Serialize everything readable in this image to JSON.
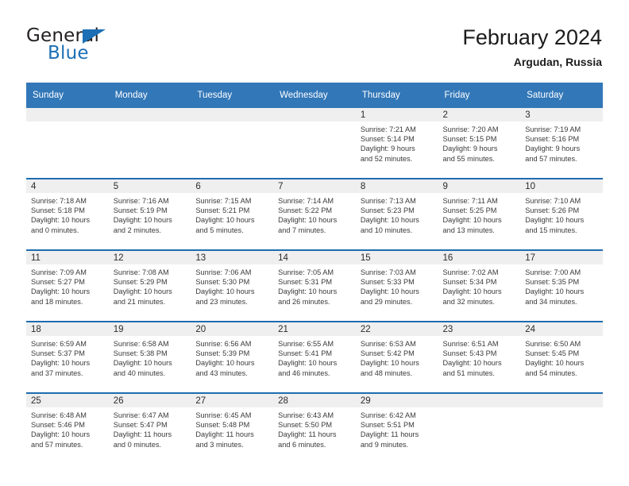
{
  "brand": {
    "name_part1": "General",
    "name_part2": "Blue",
    "logo_icon": "triangle-logo-icon"
  },
  "header": {
    "title": "February 2024",
    "location": "Argudan, Russia"
  },
  "colors": {
    "header_blue": "#3277b8",
    "row_divider_blue": "#1f6cb0",
    "daynum_band": "#efefef",
    "brand_blue": "#1c6fb5",
    "text": "#3a3a3a"
  },
  "calendar": {
    "weekday_headers": [
      "Sunday",
      "Monday",
      "Tuesday",
      "Wednesday",
      "Thursday",
      "Friday",
      "Saturday"
    ],
    "weeks": [
      [
        {
          "day": ""
        },
        {
          "day": ""
        },
        {
          "day": ""
        },
        {
          "day": ""
        },
        {
          "day": "1",
          "sunrise": "Sunrise: 7:21 AM",
          "sunset": "Sunset: 5:14 PM",
          "daylight_line1": "Daylight: 9 hours",
          "daylight_line2": "and 52 minutes."
        },
        {
          "day": "2",
          "sunrise": "Sunrise: 7:20 AM",
          "sunset": "Sunset: 5:15 PM",
          "daylight_line1": "Daylight: 9 hours",
          "daylight_line2": "and 55 minutes."
        },
        {
          "day": "3",
          "sunrise": "Sunrise: 7:19 AM",
          "sunset": "Sunset: 5:16 PM",
          "daylight_line1": "Daylight: 9 hours",
          "daylight_line2": "and 57 minutes."
        }
      ],
      [
        {
          "day": "4",
          "sunrise": "Sunrise: 7:18 AM",
          "sunset": "Sunset: 5:18 PM",
          "daylight_line1": "Daylight: 10 hours",
          "daylight_line2": "and 0 minutes."
        },
        {
          "day": "5",
          "sunrise": "Sunrise: 7:16 AM",
          "sunset": "Sunset: 5:19 PM",
          "daylight_line1": "Daylight: 10 hours",
          "daylight_line2": "and 2 minutes."
        },
        {
          "day": "6",
          "sunrise": "Sunrise: 7:15 AM",
          "sunset": "Sunset: 5:21 PM",
          "daylight_line1": "Daylight: 10 hours",
          "daylight_line2": "and 5 minutes."
        },
        {
          "day": "7",
          "sunrise": "Sunrise: 7:14 AM",
          "sunset": "Sunset: 5:22 PM",
          "daylight_line1": "Daylight: 10 hours",
          "daylight_line2": "and 7 minutes."
        },
        {
          "day": "8",
          "sunrise": "Sunrise: 7:13 AM",
          "sunset": "Sunset: 5:23 PM",
          "daylight_line1": "Daylight: 10 hours",
          "daylight_line2": "and 10 minutes."
        },
        {
          "day": "9",
          "sunrise": "Sunrise: 7:11 AM",
          "sunset": "Sunset: 5:25 PM",
          "daylight_line1": "Daylight: 10 hours",
          "daylight_line2": "and 13 minutes."
        },
        {
          "day": "10",
          "sunrise": "Sunrise: 7:10 AM",
          "sunset": "Sunset: 5:26 PM",
          "daylight_line1": "Daylight: 10 hours",
          "daylight_line2": "and 15 minutes."
        }
      ],
      [
        {
          "day": "11",
          "sunrise": "Sunrise: 7:09 AM",
          "sunset": "Sunset: 5:27 PM",
          "daylight_line1": "Daylight: 10 hours",
          "daylight_line2": "and 18 minutes."
        },
        {
          "day": "12",
          "sunrise": "Sunrise: 7:08 AM",
          "sunset": "Sunset: 5:29 PM",
          "daylight_line1": "Daylight: 10 hours",
          "daylight_line2": "and 21 minutes."
        },
        {
          "day": "13",
          "sunrise": "Sunrise: 7:06 AM",
          "sunset": "Sunset: 5:30 PM",
          "daylight_line1": "Daylight: 10 hours",
          "daylight_line2": "and 23 minutes."
        },
        {
          "day": "14",
          "sunrise": "Sunrise: 7:05 AM",
          "sunset": "Sunset: 5:31 PM",
          "daylight_line1": "Daylight: 10 hours",
          "daylight_line2": "and 26 minutes."
        },
        {
          "day": "15",
          "sunrise": "Sunrise: 7:03 AM",
          "sunset": "Sunset: 5:33 PM",
          "daylight_line1": "Daylight: 10 hours",
          "daylight_line2": "and 29 minutes."
        },
        {
          "day": "16",
          "sunrise": "Sunrise: 7:02 AM",
          "sunset": "Sunset: 5:34 PM",
          "daylight_line1": "Daylight: 10 hours",
          "daylight_line2": "and 32 minutes."
        },
        {
          "day": "17",
          "sunrise": "Sunrise: 7:00 AM",
          "sunset": "Sunset: 5:35 PM",
          "daylight_line1": "Daylight: 10 hours",
          "daylight_line2": "and 34 minutes."
        }
      ],
      [
        {
          "day": "18",
          "sunrise": "Sunrise: 6:59 AM",
          "sunset": "Sunset: 5:37 PM",
          "daylight_line1": "Daylight: 10 hours",
          "daylight_line2": "and 37 minutes."
        },
        {
          "day": "19",
          "sunrise": "Sunrise: 6:58 AM",
          "sunset": "Sunset: 5:38 PM",
          "daylight_line1": "Daylight: 10 hours",
          "daylight_line2": "and 40 minutes."
        },
        {
          "day": "20",
          "sunrise": "Sunrise: 6:56 AM",
          "sunset": "Sunset: 5:39 PM",
          "daylight_line1": "Daylight: 10 hours",
          "daylight_line2": "and 43 minutes."
        },
        {
          "day": "21",
          "sunrise": "Sunrise: 6:55 AM",
          "sunset": "Sunset: 5:41 PM",
          "daylight_line1": "Daylight: 10 hours",
          "daylight_line2": "and 46 minutes."
        },
        {
          "day": "22",
          "sunrise": "Sunrise: 6:53 AM",
          "sunset": "Sunset: 5:42 PM",
          "daylight_line1": "Daylight: 10 hours",
          "daylight_line2": "and 48 minutes."
        },
        {
          "day": "23",
          "sunrise": "Sunrise: 6:51 AM",
          "sunset": "Sunset: 5:43 PM",
          "daylight_line1": "Daylight: 10 hours",
          "daylight_line2": "and 51 minutes."
        },
        {
          "day": "24",
          "sunrise": "Sunrise: 6:50 AM",
          "sunset": "Sunset: 5:45 PM",
          "daylight_line1": "Daylight: 10 hours",
          "daylight_line2": "and 54 minutes."
        }
      ],
      [
        {
          "day": "25",
          "sunrise": "Sunrise: 6:48 AM",
          "sunset": "Sunset: 5:46 PM",
          "daylight_line1": "Daylight: 10 hours",
          "daylight_line2": "and 57 minutes."
        },
        {
          "day": "26",
          "sunrise": "Sunrise: 6:47 AM",
          "sunset": "Sunset: 5:47 PM",
          "daylight_line1": "Daylight: 11 hours",
          "daylight_line2": "and 0 minutes."
        },
        {
          "day": "27",
          "sunrise": "Sunrise: 6:45 AM",
          "sunset": "Sunset: 5:48 PM",
          "daylight_line1": "Daylight: 11 hours",
          "daylight_line2": "and 3 minutes."
        },
        {
          "day": "28",
          "sunrise": "Sunrise: 6:43 AM",
          "sunset": "Sunset: 5:50 PM",
          "daylight_line1": "Daylight: 11 hours",
          "daylight_line2": "and 6 minutes."
        },
        {
          "day": "29",
          "sunrise": "Sunrise: 6:42 AM",
          "sunset": "Sunset: 5:51 PM",
          "daylight_line1": "Daylight: 11 hours",
          "daylight_line2": "and 9 minutes."
        },
        {
          "day": ""
        },
        {
          "day": ""
        }
      ]
    ]
  }
}
